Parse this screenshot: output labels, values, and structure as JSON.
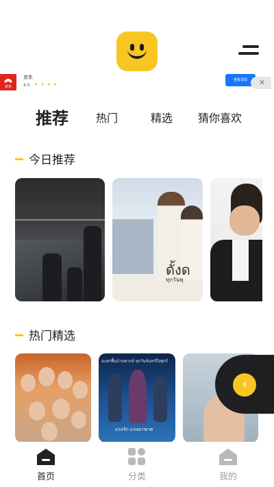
{
  "ad": {
    "app_name": "京东",
    "logo_text": "京东",
    "rating": "4.0",
    "stars": "★ ★ ★ ★",
    "button_label": "查看详情",
    "close_label": "✕"
  },
  "tabs": [
    {
      "label": "推荐"
    },
    {
      "label": "热门"
    },
    {
      "label": "精选"
    },
    {
      "label": "猜你喜欢"
    }
  ],
  "sections": {
    "today": "今日推荐",
    "hot": "热门精选"
  },
  "posters": {
    "card2_title": "ดั้งด",
    "card2_sub": "ทุกวันพุ",
    "hot2_top": "ละครพื้นบ้านพากย์ ทุกวันจันทร์ถึงศุกร์",
    "hot2_bottom": "แรงรัก แรงอาฆาต"
  },
  "colors": {
    "accent": "#f7c623",
    "dark": "#1f1f22",
    "inactive": "#9b9b9b"
  },
  "float_button": {
    "icon": "chevron-left-icon",
    "glyph": "‹"
  },
  "bottom_nav": [
    {
      "label": "首页",
      "icon": "home-icon",
      "active": true
    },
    {
      "label": "分类",
      "icon": "category-grid-icon",
      "active": false
    },
    {
      "label": "我的",
      "icon": "profile-house-icon",
      "active": false
    }
  ]
}
